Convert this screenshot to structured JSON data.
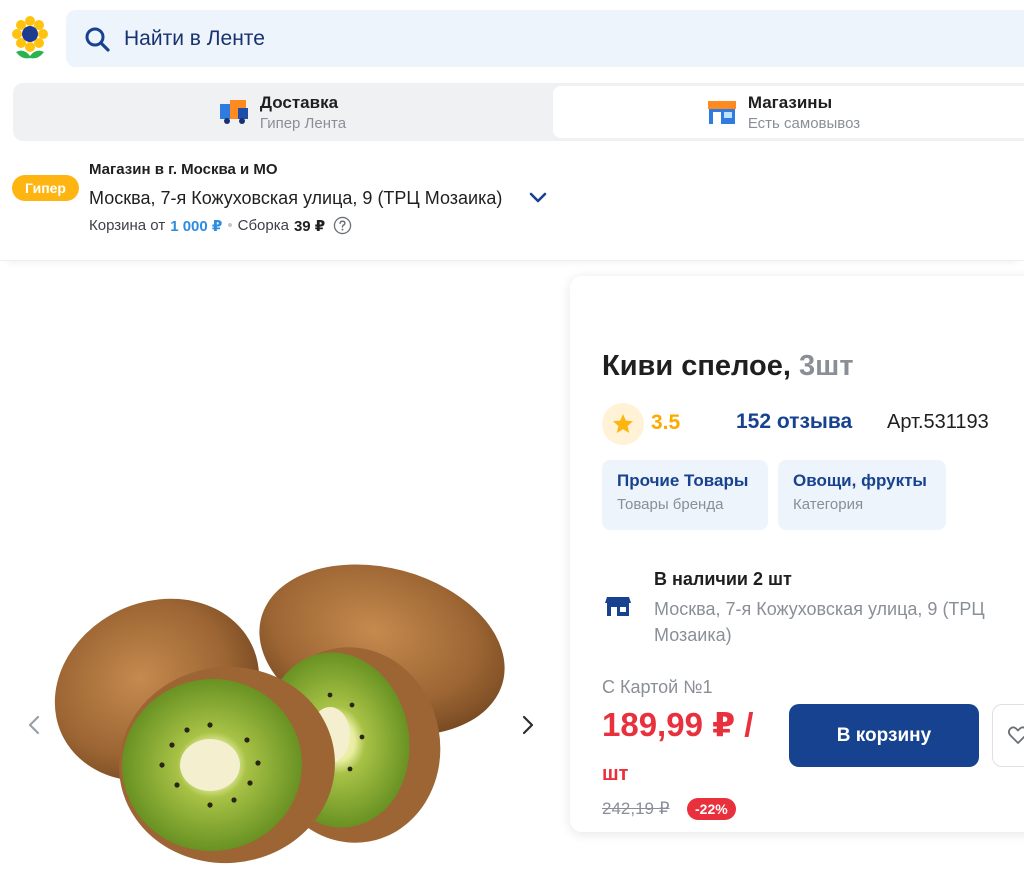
{
  "header": {
    "logo": "lenta-sunflower-logo",
    "search_placeholder": "Найти в Ленте"
  },
  "modes": [
    {
      "title": "Доставка",
      "subtitle": "Гипер Лента",
      "icon": "delivery-truck-icon"
    },
    {
      "title": "Магазины",
      "subtitle": "Есть самовывоз",
      "icon": "store-icon",
      "selected": true
    }
  ],
  "store": {
    "badge": "Гипер",
    "region": "Магазин в г. Москва и МО",
    "address": "Москва, 7-я Кожуховская улица, 9 (ТРЦ Мозаика)",
    "cart_from_label": "Корзина от",
    "cart_from_value": "1 000 ₽",
    "assembly_label": "Сборка",
    "assembly_value": "39 ₽"
  },
  "product": {
    "image": "kiwi-fruits",
    "title": "Киви спелое,",
    "unit": "3шт",
    "rating": "3.5",
    "reviews": "152 отзыва",
    "article": "Арт.531193",
    "chips": [
      {
        "title": "Прочие Товары",
        "subtitle": "Товары бренда"
      },
      {
        "title": "Овощи, фрукты",
        "subtitle": "Категория"
      }
    ],
    "availability": "В наличии 2 шт",
    "availability_address": "Москва, 7-я Кожуховская улица, 9 (ТРЦ Мозаика)",
    "card_label": "С Картой №1",
    "price": "189,99 ₽ /",
    "price_unit": "шт",
    "old_price": "242,19 ₽",
    "discount": "-22%",
    "cart_button": "В корзину"
  },
  "colors": {
    "brand_blue": "#17428f",
    "price_red": "#e8313d",
    "rating_yellow": "#ffa900",
    "hyper_badge": "#ffb511"
  }
}
